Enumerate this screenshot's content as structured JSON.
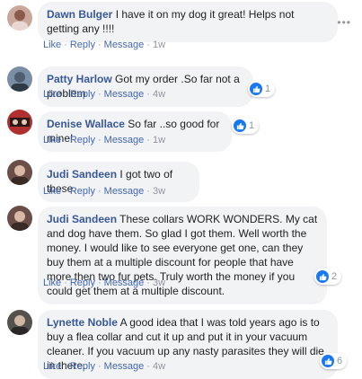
{
  "comments": [
    {
      "author": "Dawn Bulger",
      "text": "I have it on my dog it great! Helps not getting any !!!!",
      "actions": {
        "like": "Like",
        "reply": "Reply",
        "message": "Message",
        "time": "1w"
      },
      "reactions": null,
      "avatar_color": "#c9a79b"
    },
    {
      "author": "Patty Harlow",
      "text": "Got my order .So far not a problem",
      "actions": {
        "like": "Like",
        "reply": "Reply",
        "message": "Message",
        "time": "4w"
      },
      "reactions": "1",
      "avatar_color": "#7a8fa6"
    },
    {
      "author": "Denise Wallace",
      "text": "So far ..so good for mine!",
      "actions": {
        "like": "Like",
        "reply": "Reply",
        "message": "Message",
        "time": "1w"
      },
      "reactions": "1",
      "avatar_color": "#b0302f"
    },
    {
      "author": "Judi Sandeen",
      "text": "I got two of these.",
      "actions": {
        "like": "Like",
        "reply": "Reply",
        "message": "Message",
        "time": "3w"
      },
      "reactions": null,
      "avatar_color": "#6b4e47"
    },
    {
      "author": "Judi Sandeen",
      "text": "These collars WORK WONDERS. My cat and dog have them. So glad I got them. Well worth the money. I would like to see everyone get one, can they buy them at a multiple discount for people that have more then two fur pets. Truly worth the money if you could get them at a multiple discount.",
      "actions": {
        "like": "Like",
        "reply": "Reply",
        "message": "Message",
        "time": "3w"
      },
      "reactions": "2",
      "avatar_color": "#6b4e47"
    },
    {
      "author": "Lynette Noble",
      "text": "A good idea that I was told years ago is to buy a flea collar and cut it up and put it in your vacuum cleaner. If you vacuum up any nasty parasites they will die in there.",
      "actions": {
        "like": "Like",
        "reply": "Reply",
        "message": "Message",
        "time": "4w"
      },
      "reactions": "6",
      "avatar_color": "#55524e"
    }
  ],
  "more_icon": "ellipsis-icon"
}
